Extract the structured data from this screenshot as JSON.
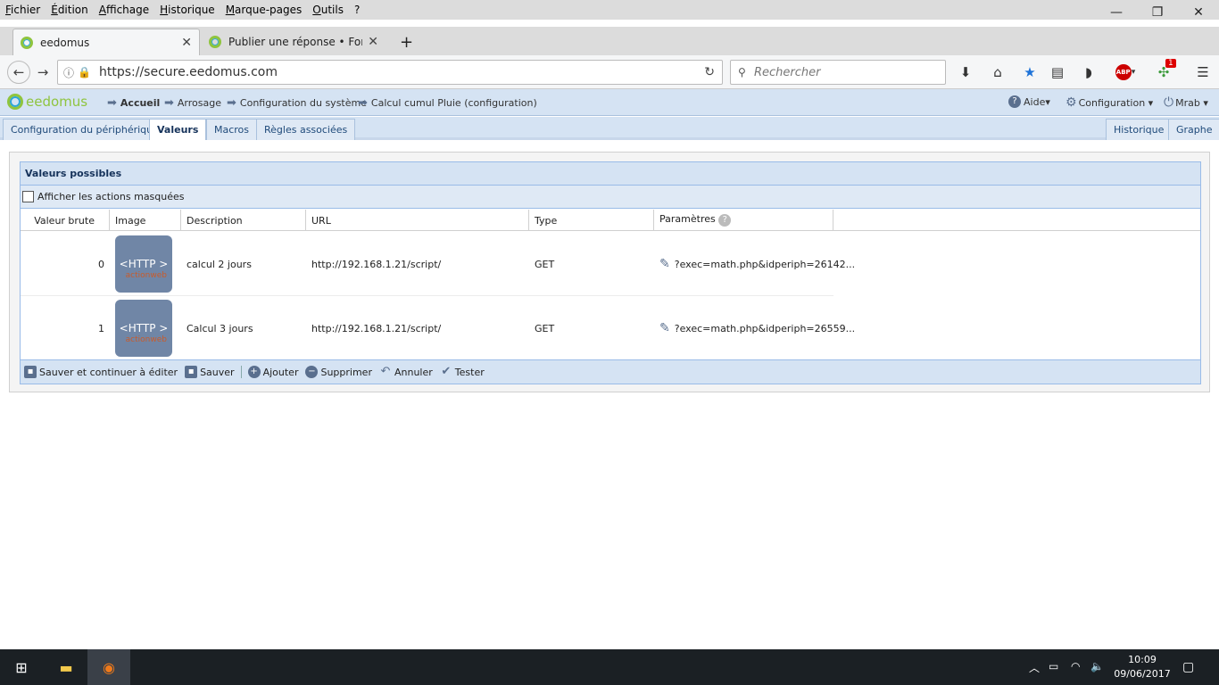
{
  "menu": [
    "Fichier",
    "Édition",
    "Affichage",
    "Historique",
    "Marque-pages",
    "Outils",
    "?"
  ],
  "window": {
    "minimize": "—",
    "restore": "❐",
    "close": "✕"
  },
  "tabs": [
    {
      "title": "eedomus"
    },
    {
      "title": "Publier une réponse • Forum"
    }
  ],
  "new_tab": "+",
  "url": "https://secure.eedomus.com",
  "search_placeholder": "Rechercher",
  "abp_badge": "1",
  "app": {
    "logo_text": "eedomus",
    "breadcrumb": [
      "Accueil",
      "Arrosage",
      "Configuration du système",
      "Calcul cumul Pluie (configuration)"
    ],
    "help": "Aide",
    "config": "Configuration",
    "user": "Mrab"
  },
  "subtabs": [
    "Configuration du périphérique",
    "Valeurs",
    "Macros",
    "Règles associées"
  ],
  "right_tabs": [
    "Historique",
    "Graphe"
  ],
  "panel": {
    "title": "Valeurs possibles",
    "show_hidden": "Afficher les actions masquées",
    "columns": [
      "Valeur brute",
      "Image",
      "Description",
      "URL",
      "Type",
      "Paramètres"
    ],
    "rows": [
      {
        "raw": "0",
        "img_label": "<HTTP >",
        "img_sub": "actionweb",
        "desc": "calcul 2 jours",
        "url": "http://192.168.1.21/script/",
        "type": "GET",
        "params": "?exec=math.php&idperiph=26142..."
      },
      {
        "raw": "1",
        "img_label": "<HTTP >",
        "img_sub": "actionweb",
        "desc": "Calcul 3 jours",
        "url": "http://192.168.1.21/script/",
        "type": "GET",
        "params": "?exec=math.php&idperiph=26559..."
      }
    ],
    "footer": {
      "save_continue": "Sauver et continuer à éditer",
      "save": "Sauver",
      "add": "Ajouter",
      "delete": "Supprimer",
      "cancel": "Annuler",
      "test": "Tester"
    }
  },
  "clock": {
    "time": "10:09",
    "date": "09/06/2017"
  }
}
